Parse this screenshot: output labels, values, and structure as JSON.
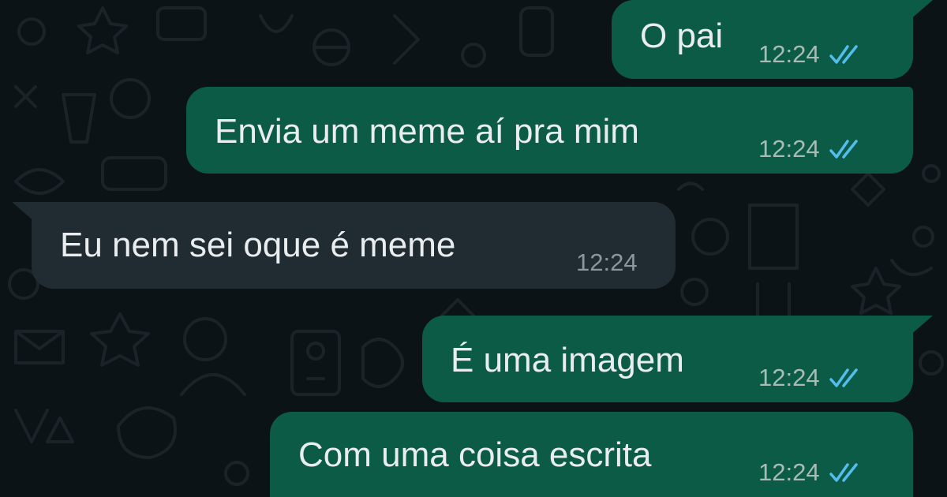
{
  "theme": {
    "background": "#0c1317",
    "outgoing_bubble": "#0c5b46",
    "incoming_bubble": "#212c32",
    "text_color": "#e9edef",
    "read_tick_color": "#53bdeb"
  },
  "messages": [
    {
      "direction": "outgoing",
      "text": "O pai",
      "time": "12:24",
      "status": "read"
    },
    {
      "direction": "outgoing",
      "text": "Envia um meme aí pra mim",
      "time": "12:24",
      "status": "read"
    },
    {
      "direction": "incoming",
      "text": "Eu nem sei oque é meme",
      "time": "12:24"
    },
    {
      "direction": "outgoing",
      "text": "É uma imagem",
      "time": "12:24",
      "status": "read"
    },
    {
      "direction": "outgoing",
      "text": "Com uma coisa escrita",
      "time": "12:24",
      "status": "read"
    }
  ]
}
